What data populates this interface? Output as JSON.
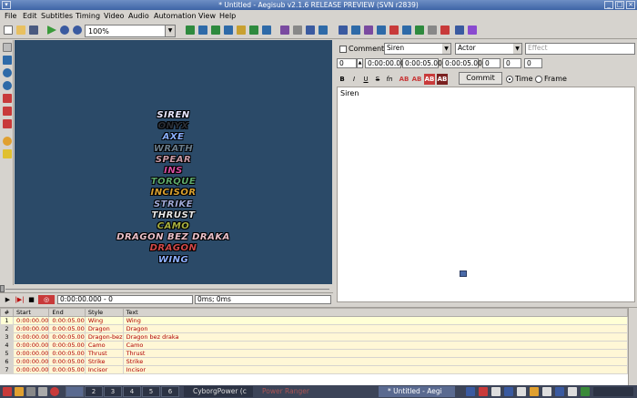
{
  "window": {
    "title": "* Untitled - Aegisub v2.1.6 RELEASE PREVIEW (SVN r2839)"
  },
  "menu": [
    "File",
    "Edit",
    "Subtitles",
    "Timing",
    "Video",
    "Audio",
    "Automation",
    "View",
    "Help"
  ],
  "toolbar": {
    "zoom_value": "100%"
  },
  "video": {
    "lines": [
      {
        "text": "SIREN",
        "color": "#e7e7ff"
      },
      {
        "text": "ONYX",
        "color": "#2a2e35"
      },
      {
        "text": "AXE",
        "color": "#8ab0ff"
      },
      {
        "text": "WRATH",
        "color": "#6a7c8a"
      },
      {
        "text": "SPEAR",
        "color": "#c89aa6"
      },
      {
        "text": "INS",
        "color": "#d74ea0"
      },
      {
        "text": "TORQUE",
        "color": "#5ea86a"
      },
      {
        "text": "INCISOR",
        "color": "#d8a030"
      },
      {
        "text": "STRIKE",
        "color": "#9ea8d6"
      },
      {
        "text": "THRUST",
        "color": "#e6e6e6"
      },
      {
        "text": "CAMO",
        "color": "#a8b040"
      },
      {
        "text": "DRAGON BEZ DRAKA",
        "color": "#e8bfc8"
      },
      {
        "text": "DRAGON",
        "color": "#d04848"
      },
      {
        "text": "WING",
        "color": "#8eb0ff"
      }
    ]
  },
  "video_controls": {
    "time": "0:00:00.000 - 0",
    "offset": "0ms; 0ms"
  },
  "edit": {
    "comment_label": "Comment",
    "style": "Siren",
    "actor": "Actor",
    "effect_placeholder": "Effect",
    "layer": "0",
    "start": "0:00:00.00",
    "end": "0:00:05.00",
    "duration": "0:00:05.00",
    "margin_l": "0",
    "margin_r": "0",
    "margin_v": "0",
    "format_buttons": [
      "B",
      "I",
      "U",
      "S",
      "fn",
      "AB",
      "AB",
      "AB",
      "AB"
    ],
    "commit_label": "Commit",
    "time_label": "Time",
    "frame_label": "Frame",
    "text": "Siren"
  },
  "grid": {
    "headers": [
      "#",
      "Start",
      "End",
      "Style",
      "Text"
    ],
    "rows": [
      {
        "n": "1",
        "start": "0:00:00.00",
        "end": "0:00:05.00",
        "style": "Wing",
        "text": "Wing"
      },
      {
        "n": "2",
        "start": "0:00:00.00",
        "end": "0:00:05.00",
        "style": "Dragon",
        "text": "Dragon"
      },
      {
        "n": "3",
        "start": "0:00:00.00",
        "end": "0:00:05.00",
        "style": "Dragon-bez",
        "text": "Dragon bez draka"
      },
      {
        "n": "4",
        "start": "0:00:00.00",
        "end": "0:00:05.00",
        "style": "Camo",
        "text": "Camo"
      },
      {
        "n": "5",
        "start": "0:00:00.00",
        "end": "0:00:05.00",
        "style": "Thrust",
        "text": "Thrust"
      },
      {
        "n": "6",
        "start": "0:00:00.00",
        "end": "0:00:05.00",
        "style": "Strike",
        "text": "Strike"
      },
      {
        "n": "7",
        "start": "0:00:00.00",
        "end": "0:00:05.00",
        "style": "Incisor",
        "text": "Incisor"
      }
    ]
  },
  "taskbar": {
    "workspaces": [
      "2",
      "3",
      "4",
      "5",
      "6"
    ],
    "tasks": [
      "CyborgPower (c",
      "Power Ranger",
      "",
      "* Untitled - Aegi"
    ]
  }
}
